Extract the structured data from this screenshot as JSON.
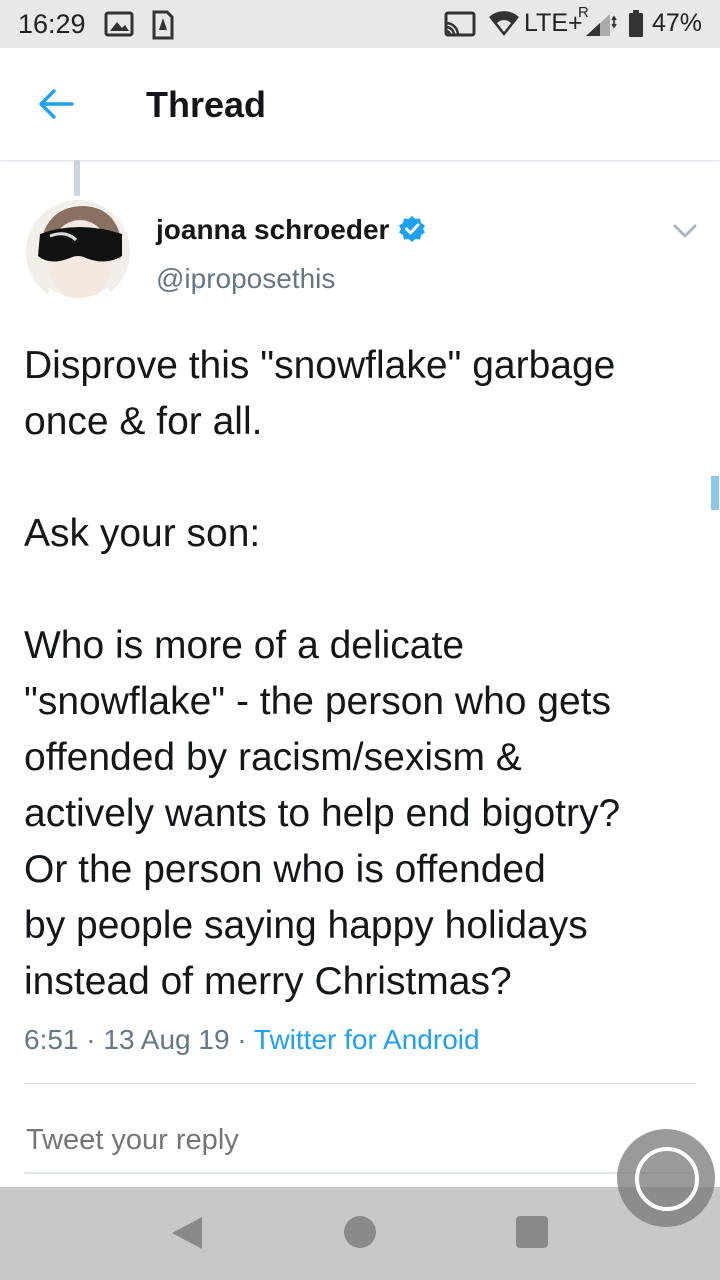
{
  "status_bar": {
    "time": "16:29",
    "network": "LTE+",
    "roaming": "R",
    "battery": "47%",
    "icons": [
      "image-icon",
      "sim-icon",
      "cast-icon",
      "wifi-icon",
      "signal-icon",
      "battery-icon"
    ]
  },
  "header": {
    "title": "Thread",
    "back_icon": "arrow-left-icon"
  },
  "tweet": {
    "display_name": "joanna schroeder",
    "handle": "@iproposethis",
    "verified": true,
    "paragraphs": [
      [
        "Disprove this \"snowflake\" garbage",
        "once & for all."
      ],
      [
        "Ask your son:"
      ],
      [
        "Who is more of a delicate",
        "\"snowflake\" - the person who gets",
        "offended by racism/sexism &",
        "actively wants to help end bigotry?",
        "Or the person who is offended",
        "by people saying happy holidays",
        "instead of merry Christmas?"
      ]
    ],
    "time": "6:51",
    "date": "13 Aug 19",
    "separator": "·",
    "source": "Twitter for Android"
  },
  "reply": {
    "placeholder": "Tweet your reply"
  },
  "colors": {
    "accent": "#1da1f2",
    "secondary_text": "#657786",
    "status_bar_bg": "#e8e8e8",
    "nav_bar_bg": "#c8c8c8"
  }
}
